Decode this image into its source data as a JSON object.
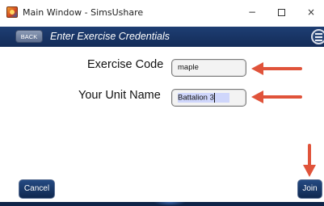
{
  "window": {
    "title": "Main Window - SimsUshare",
    "minimize": "−",
    "close": "×"
  },
  "header": {
    "back_label": "BACK",
    "title": "Enter Exercise Credentials",
    "menu_icon": "hamburger-menu-icon"
  },
  "form": {
    "exercise_code_label": "Exercise Code",
    "exercise_code_value": "maple",
    "unit_name_label": "Your Unit Name",
    "unit_name_value": "Battalion 3"
  },
  "buttons": {
    "cancel_label": "Cancel",
    "join_label": "Join"
  },
  "colors": {
    "header_navy": "#142c58",
    "annotation_arrow": "#e0533a",
    "field_selection": "#cfd6fb"
  }
}
